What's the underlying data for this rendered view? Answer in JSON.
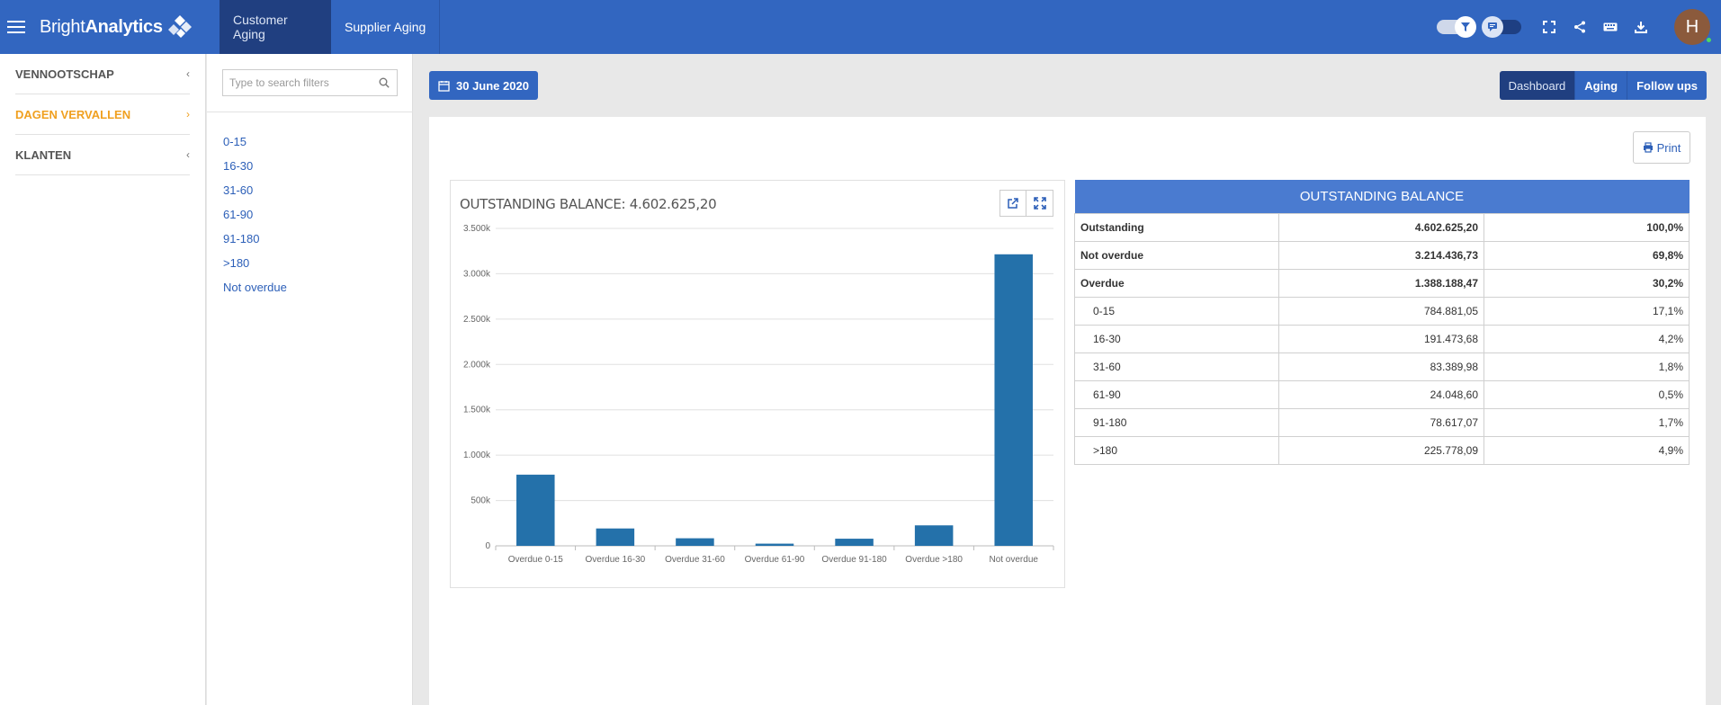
{
  "app": {
    "logo_light": "Bright",
    "logo_bold": "Analytics",
    "user_initial": "H"
  },
  "header": {
    "tabs": [
      {
        "label": "Customer Aging",
        "active": true
      },
      {
        "label": "Supplier Aging",
        "active": false
      }
    ],
    "icons": [
      "filter-toggle",
      "comment-toggle",
      "fullscreen-icon",
      "share-icon",
      "keyboard-icon",
      "download-icon"
    ]
  },
  "sidebar": {
    "items": [
      {
        "label": "VENNOOTSCHAP",
        "active": false
      },
      {
        "label": "DAGEN VERVALLEN",
        "active": true
      },
      {
        "label": "KLANTEN",
        "active": false
      }
    ]
  },
  "filters": {
    "search_placeholder": "Type to search filters",
    "items": [
      "0-15",
      "16-30",
      "31-60",
      "61-90",
      "91-180",
      ">180",
      "Not overdue"
    ]
  },
  "toolbar": {
    "date_label": "30 June 2020",
    "view_tabs": [
      {
        "label": "Dashboard",
        "active": true
      },
      {
        "label": "Aging",
        "active": false
      },
      {
        "label": "Follow ups",
        "active": false
      }
    ],
    "print_label": "Print"
  },
  "chart_data": {
    "type": "bar",
    "title": "OUTSTANDING BALANCE: 4.602.625,20",
    "categories": [
      "Overdue 0-15",
      "Overdue 16-30",
      "Overdue 31-60",
      "Overdue 61-90",
      "Overdue 91-180",
      "Overdue >180",
      "Not overdue"
    ],
    "values": [
      784881.05,
      191473.68,
      83389.98,
      24048.6,
      78617.07,
      225778.09,
      3214436.73
    ],
    "ylim": [
      0,
      3500000
    ],
    "yticks": [
      0,
      500000,
      1000000,
      1500000,
      2000000,
      2500000,
      3000000,
      3500000
    ],
    "ytick_labels": [
      "0",
      "500k",
      "1.000k",
      "1.500k",
      "2.000k",
      "2.500k",
      "3.000k",
      "3.500k"
    ],
    "grid": true,
    "bar_color": "#2471aa"
  },
  "balance_table": {
    "title": "OUTSTANDING BALANCE",
    "rows": [
      {
        "label": "Outstanding",
        "amount": "4.602.625,20",
        "pct": "100,0%",
        "bold": true
      },
      {
        "label": "Not overdue",
        "amount": "3.214.436,73",
        "pct": "69,8%",
        "bold": true
      },
      {
        "label": "Overdue",
        "amount": "1.388.188,47",
        "pct": "30,2%",
        "bold": true
      },
      {
        "label": "0-15",
        "amount": "784.881,05",
        "pct": "17,1%",
        "bold": false
      },
      {
        "label": "16-30",
        "amount": "191.473,68",
        "pct": "4,2%",
        "bold": false
      },
      {
        "label": "31-60",
        "amount": "83.389,98",
        "pct": "1,8%",
        "bold": false
      },
      {
        "label": "61-90",
        "amount": "24.048,60",
        "pct": "0,5%",
        "bold": false
      },
      {
        "label": "91-180",
        "amount": "78.617,07",
        "pct": "1,7%",
        "bold": false
      },
      {
        "label": ">180",
        "amount": "225.778,09",
        "pct": "4,9%",
        "bold": false
      }
    ]
  }
}
